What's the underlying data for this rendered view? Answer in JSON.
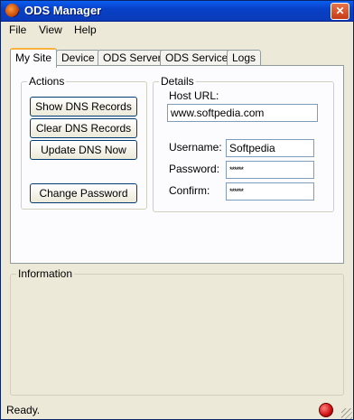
{
  "window": {
    "title": "ODS Manager",
    "close_label": "✕"
  },
  "menu": [
    "File",
    "View",
    "Help"
  ],
  "tabs": [
    "My Site",
    "Device",
    "ODS Server",
    "ODS Service",
    "Logs"
  ],
  "actions": {
    "label": "Actions",
    "show_dns": "Show DNS Records",
    "clear_dns": "Clear DNS Records",
    "update_dns": "Update DNS Now",
    "change_password": "Change Password"
  },
  "details": {
    "label": "Details",
    "host_url_label": "Host URL:",
    "host_url_value": "www.softpedia.com",
    "username_label": "Username:",
    "username_value": "Softpedia",
    "password_label": "Password:",
    "password_value": "******",
    "confirm_label": "Confirm:",
    "confirm_value": "******"
  },
  "information": {
    "label": "Information"
  },
  "status": {
    "text": "Ready.",
    "led_color": "#d01010"
  },
  "colors": {
    "titlebar": "#0a4fd8",
    "face": "#ece9d8",
    "panel": "#fcfcfe"
  }
}
